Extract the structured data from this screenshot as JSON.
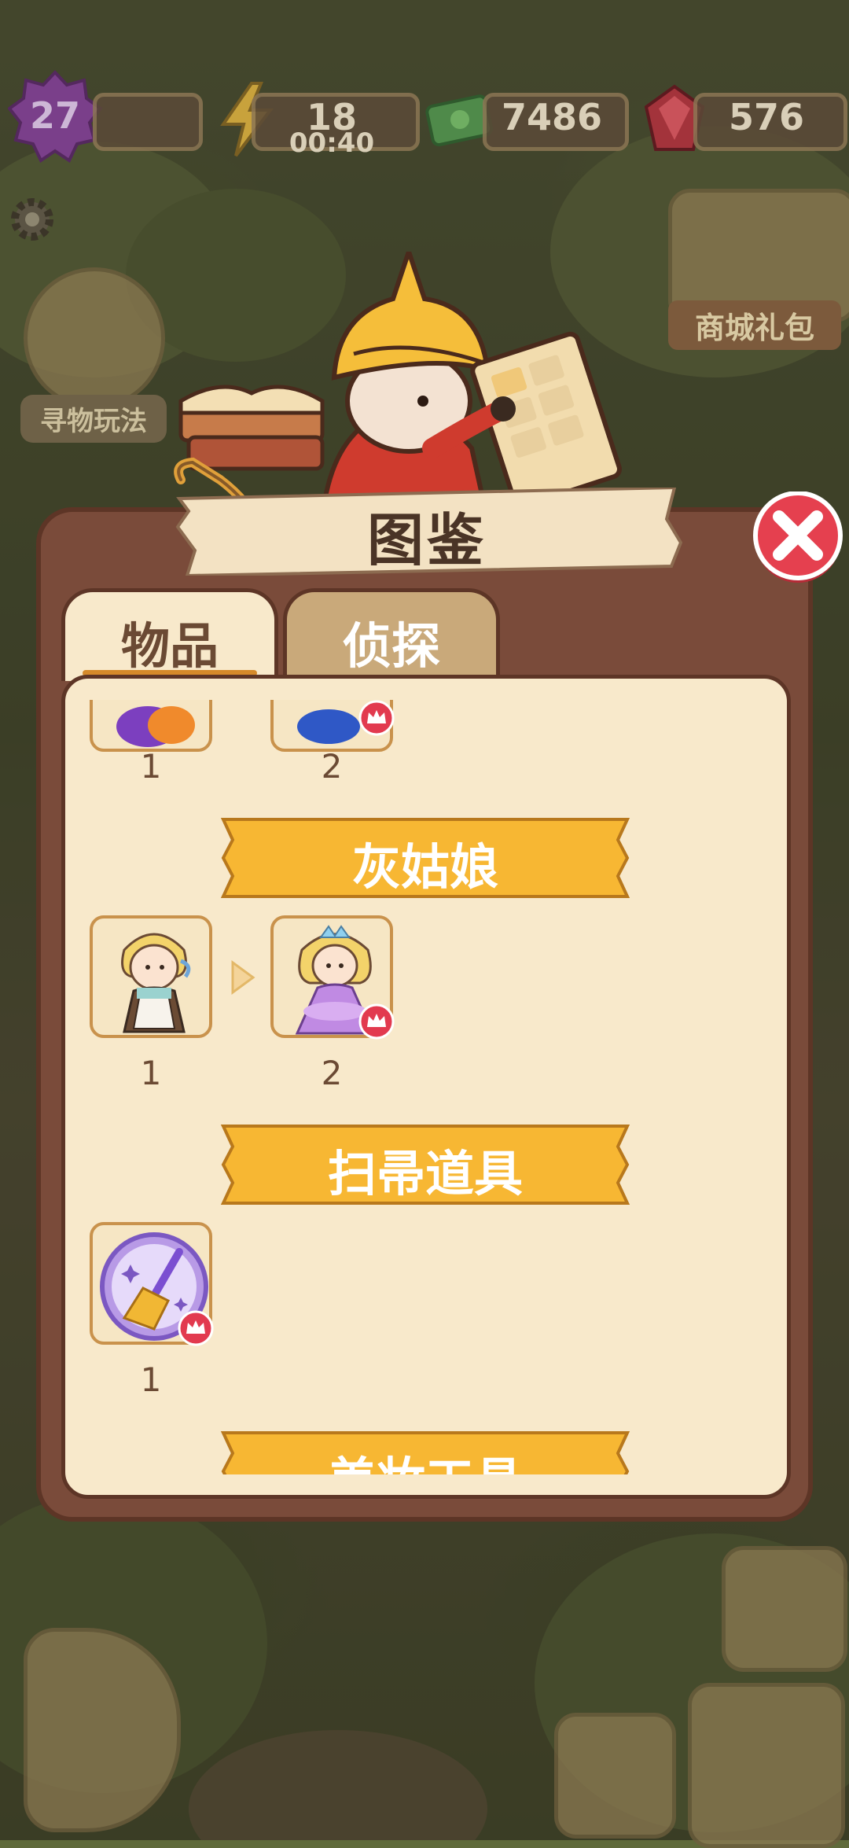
{
  "hud": {
    "level": "27",
    "energy": "18",
    "energy_timer": "00:40",
    "cash": "7486",
    "gems": "576"
  },
  "side_buttons": {
    "shop_pack_label": "商城礼包",
    "find_item_label": "寻物玩法"
  },
  "dialog": {
    "title": "图鉴",
    "tabs": [
      {
        "label": "物品",
        "active": true
      },
      {
        "label": "侦探",
        "active": false
      }
    ],
    "top_partial_row": {
      "items": [
        {
          "num": "1"
        },
        {
          "num": "2"
        }
      ]
    },
    "sections": [
      {
        "title": "灰姑娘",
        "items": [
          {
            "num": "1",
            "icon": "cinderella-maid"
          },
          {
            "num": "2",
            "icon": "cinderella-princess"
          }
        ]
      },
      {
        "title": "扫帚道具",
        "items": [
          {
            "num": "1",
            "icon": "broom"
          }
        ]
      },
      {
        "title": "美妆工具",
        "items": []
      }
    ]
  },
  "colors": {
    "accent_banner": "#f7b733",
    "panel_bg": "#f8e9cb",
    "dialog_frame": "#7a4b3a",
    "close_red": "#e5404f"
  }
}
